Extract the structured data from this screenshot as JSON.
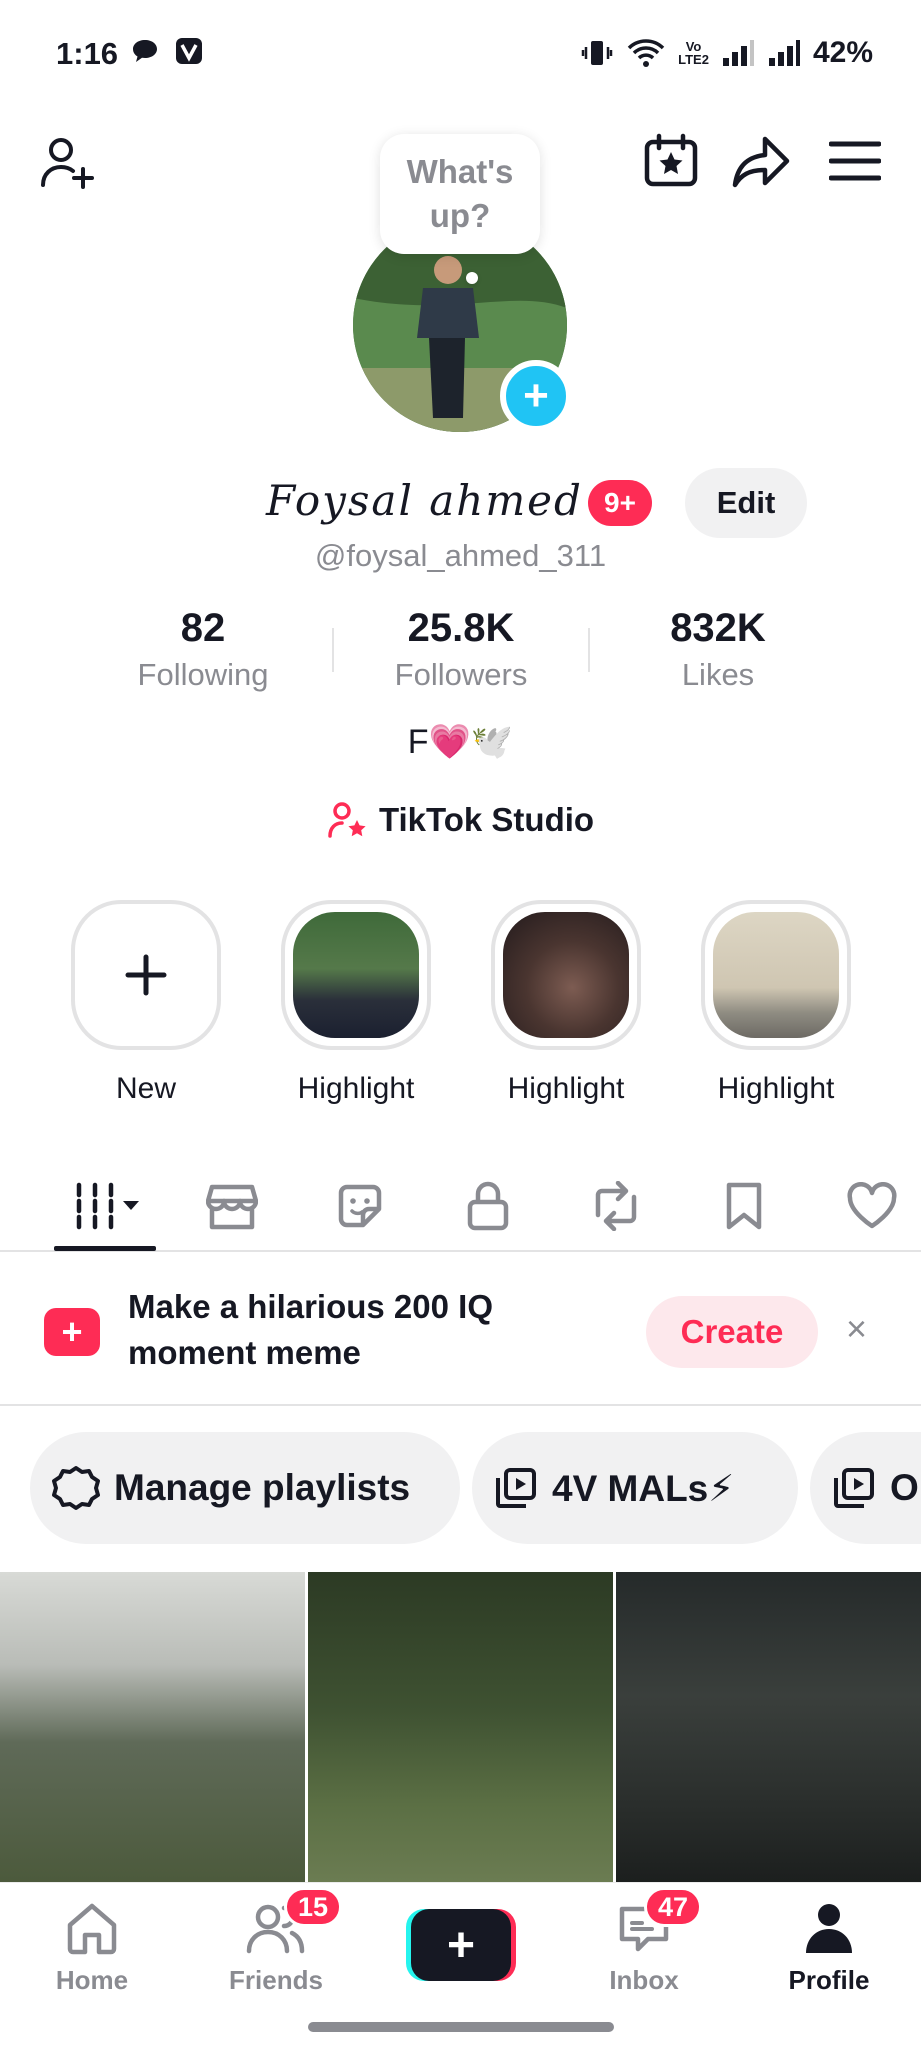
{
  "status_bar": {
    "time": "1:16",
    "battery": "42%",
    "volte": "Vo",
    "lte": "LTE2"
  },
  "header": {
    "bubble_text": "What's up?"
  },
  "profile": {
    "display_name": "Foysal ahmed",
    "notif_badge": "9+",
    "edit_label": "Edit",
    "username": "@foysal_ahmed_311",
    "bio": "F💗🕊️",
    "studio_label": "TikTok Studio"
  },
  "stats": [
    {
      "value": "82",
      "label": "Following"
    },
    {
      "value": "25.8K",
      "label": "Followers"
    },
    {
      "value": "832K",
      "label": "Likes"
    }
  ],
  "highlights": [
    {
      "label": "New"
    },
    {
      "label": "Highlight"
    },
    {
      "label": "Highlight"
    },
    {
      "label": "Highlight"
    }
  ],
  "tabs": [
    "videos-icon",
    "shop-icon",
    "sticker-icon",
    "lock-icon",
    "repost-icon",
    "bookmark-icon",
    "heart-icon"
  ],
  "promo": {
    "text": "Make a hilarious 200 IQ moment meme",
    "create_label": "Create",
    "close_label": "×"
  },
  "chips": [
    {
      "label": "Manage playlists",
      "icon": "gear-icon"
    },
    {
      "label": "4V MALs⚡",
      "icon": "playlist-icon"
    },
    {
      "label": "O",
      "icon": "playlist-icon"
    }
  ],
  "nav": [
    {
      "label": "Home",
      "icon": "home-icon"
    },
    {
      "label": "Friends",
      "icon": "friends-icon",
      "badge": "15"
    },
    {
      "label": "",
      "icon": "create-icon"
    },
    {
      "label": "Inbox",
      "icon": "inbox-icon",
      "badge": "47"
    },
    {
      "label": "Profile",
      "icon": "profile-icon"
    }
  ],
  "colors": {
    "accent": "#fe2c55",
    "cyan": "#25f4ee",
    "text": "#161823",
    "muted": "#8a8b91"
  }
}
